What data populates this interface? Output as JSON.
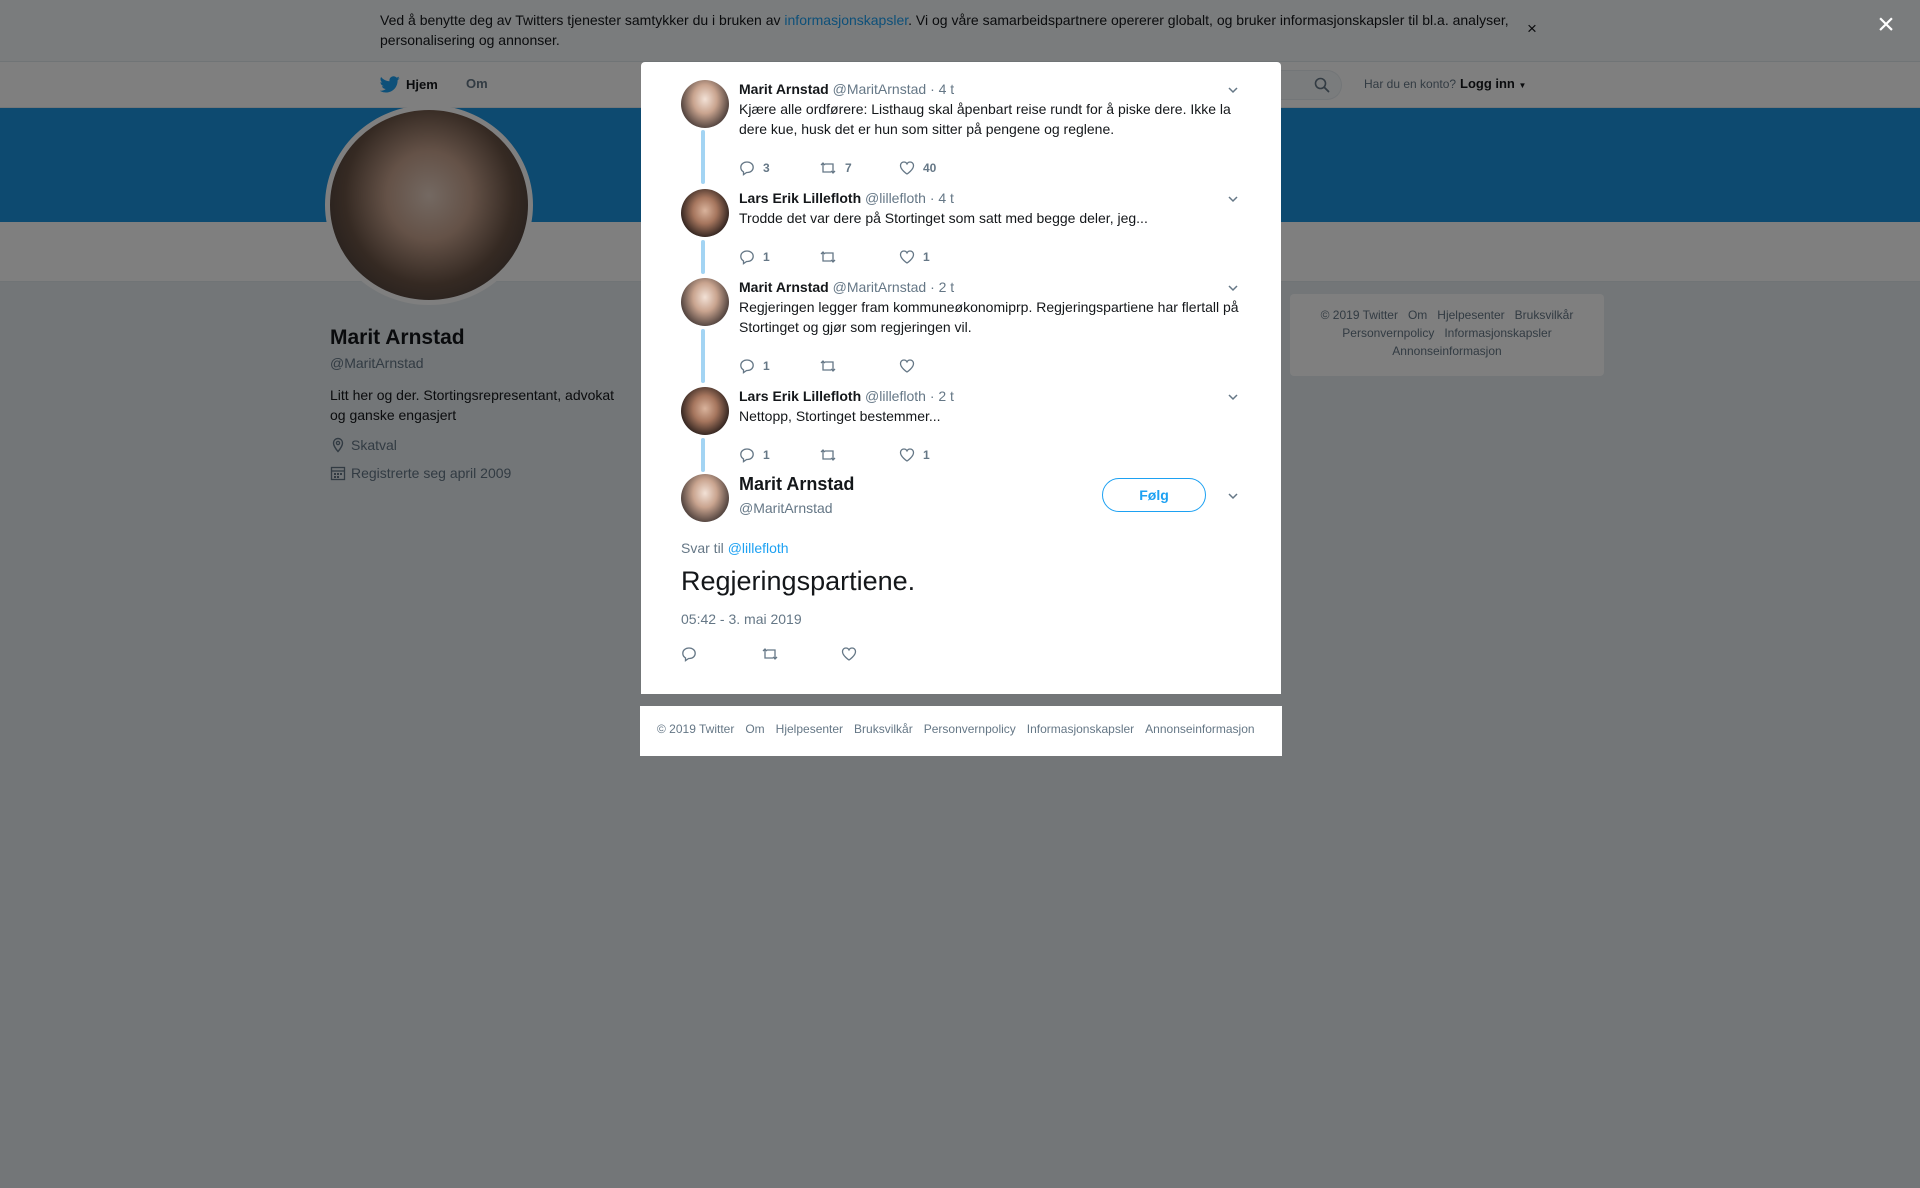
{
  "cookie_banner": {
    "text_before": "Ved å benytte deg av Twitters tjenester samtykker du i bruken av ",
    "link": "informasjonskapsler",
    "text_after": ". Vi og våre samarbeidspartnere opererer globalt, og bruker informasjonskapsler til bl.a. analyser, personalisering og annonser.",
    "close": "×"
  },
  "nav": {
    "home": "Hjem",
    "about": "Om",
    "login_prompt": "Har du en konto?",
    "login": "Logg inn"
  },
  "profile": {
    "name": "Marit Arnstad",
    "handle": "@MaritArnstad",
    "bio": "Litt her og der. Stortingsrepresentant, advokat og ganske engasjert",
    "location": "Skatval",
    "joined": "Registrerte seg april 2009"
  },
  "side_footer": {
    "items": [
      "© 2019 Twitter",
      "Om",
      "Hjelpesenter",
      "Bruksvilkår",
      "Personvernpolicy",
      "Informasjonskapsler",
      "Annonseinformasjon"
    ]
  },
  "modal_close": "×",
  "thread": [
    {
      "name": "Marit Arnstad",
      "handle": "@MaritArnstad",
      "time": "· 4 t",
      "text": "Kjære alle ordførere: Listhaug skal åpenbart reise rundt for å piske dere. Ikke la dere kue, husk det er hun som sitter på pengene og reglene.",
      "replies": "3",
      "retweets": "7",
      "likes": "40"
    },
    {
      "name": "Lars Erik Lillefloth",
      "handle": "@lillefloth",
      "time": "· 4 t",
      "text": "Trodde det var dere på Stortinget som satt med begge deler, jeg...",
      "replies": "1",
      "retweets": "",
      "likes": "1"
    },
    {
      "name": "Marit Arnstad",
      "handle": "@MaritArnstad",
      "time": "· 2 t",
      "text": "Regjeringen legger fram kommuneøkonomiprp. Regjeringspartiene har flertall på Stortinget og gjør som regjeringen vil.",
      "replies": "1",
      "retweets": "",
      "likes": ""
    },
    {
      "name": "Lars Erik Lillefloth",
      "handle": "@lillefloth",
      "time": "· 2 t",
      "text": "Nettopp, Stortinget bestemmer...",
      "replies": "1",
      "retweets": "",
      "likes": "1"
    }
  ],
  "main_tweet": {
    "name": "Marit Arnstad",
    "handle": "@MaritArnstad",
    "follow": "Følg",
    "reply_prefix": "Svar til ",
    "reply_to": "@lillefloth",
    "text": "Regjeringspartiene.",
    "timestamp": "05:42 - 3. mai 2019"
  },
  "modal_footer": {
    "items": [
      "© 2019 Twitter",
      "Om",
      "Hjelpesenter",
      "Bruksvilkår",
      "Personvernpolicy",
      "Informasjonskapsler",
      "Annonseinformasjon"
    ]
  },
  "colors": {
    "accent": "#1da1f2",
    "banner": "#1b95e0",
    "thread_line": "#a3d4f3",
    "muted": "#657786"
  }
}
